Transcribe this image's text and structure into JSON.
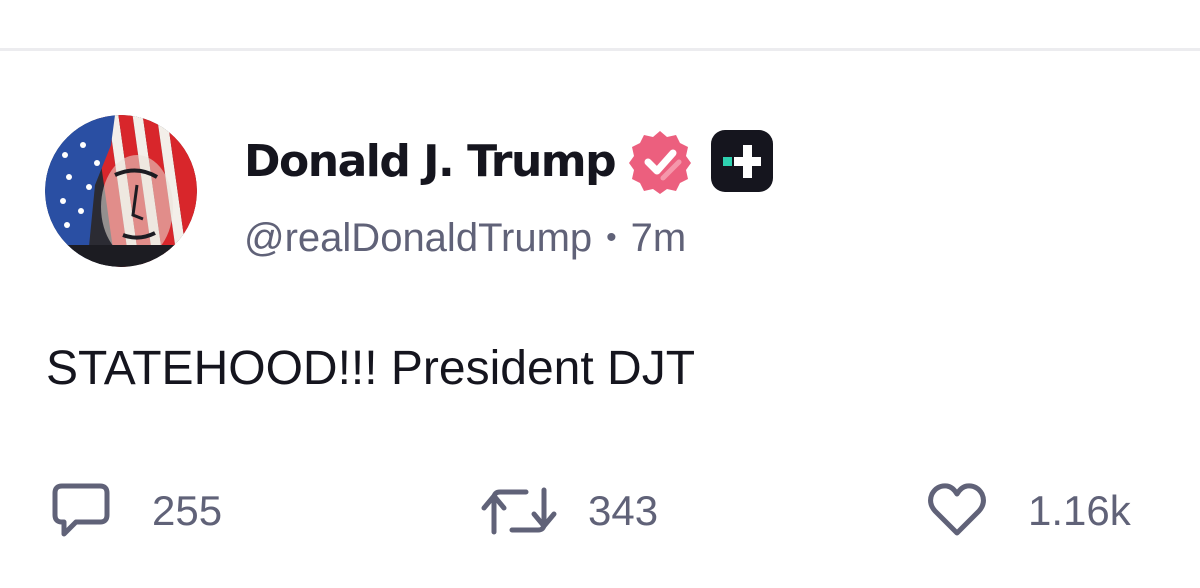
{
  "post": {
    "author": {
      "display_name": "Donald J. Trump",
      "handle": "@realDonaldTrump",
      "verified": true,
      "badges": [
        "verified-badge-icon",
        "plus-subscriber-badge-icon"
      ]
    },
    "separator": "•",
    "timestamp": "7m",
    "text": "STATEHOOD!!! President DJT",
    "actions": {
      "replies": "255",
      "reposts": "343",
      "likes": "1.16k"
    }
  },
  "colors": {
    "text_primary": "#15151e",
    "text_secondary": "#606278",
    "verified_badge": "#ec5f7e",
    "plus_badge_bg": "#15151e",
    "plus_badge_accent": "#2ed1b0",
    "divider": "#ececef"
  }
}
